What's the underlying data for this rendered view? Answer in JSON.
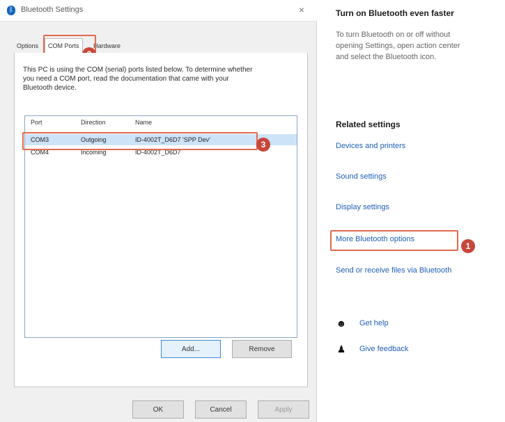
{
  "dialog": {
    "title": "Bluetooth Settings",
    "close_glyph": "×",
    "tabs": [
      {
        "label": "Options"
      },
      {
        "label": "COM Ports"
      },
      {
        "label": "Hardware"
      }
    ],
    "description": "This PC is using the COM (serial) ports listed below. To determine whether you need a COM port, read the documentation that came with your Bluetooth device.",
    "table": {
      "headers": [
        "Port",
        "Direction",
        "Name"
      ],
      "rows": [
        {
          "port": "COM3",
          "direction": "Outgoing",
          "name": "ID-4002T_D6D7 'SPP Dev'"
        },
        {
          "port": "COM4",
          "direction": "Incoming",
          "name": "ID-4002T_D6D7"
        }
      ]
    },
    "add_label": "Add...",
    "remove_label": "Remove",
    "ok_label": "OK",
    "cancel_label": "Cancel",
    "apply_label": "Apply"
  },
  "settings": {
    "heading_turn_on": "Turn on Bluetooth even faster",
    "turn_on_text": "To turn Bluetooth on or off without\nopening Settings, open action center\nand select the Bluetooth icon.",
    "related_heading": "Related settings",
    "links": {
      "devices": "Devices and printers",
      "sound": "Sound settings",
      "display": "Display settings",
      "more_bt": "More Bluetooth options",
      "send_receive": "Send or receive files via Bluetooth"
    },
    "help_label": "Get help",
    "feedback_label": "Give feedback"
  },
  "annotations": {
    "badge_1": "1",
    "badge_2": "2",
    "badge_3": "3",
    "highlight_color": "#e26a4e",
    "badge_color": "#c9463a"
  },
  "icons": {
    "bluetooth": "bluetooth-icon",
    "help": "help-icon",
    "feedback": "feedback-icon"
  }
}
